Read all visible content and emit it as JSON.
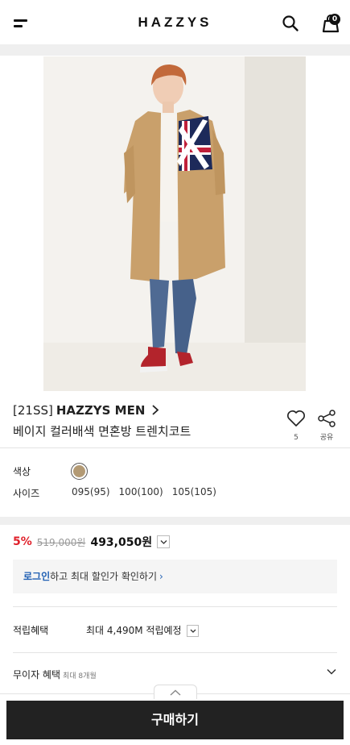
{
  "header": {
    "brand": "HAZZYS",
    "cart_count": "0",
    "icons": [
      "menu-icon",
      "search-icon",
      "cart-icon"
    ]
  },
  "product": {
    "season": "[21SS]",
    "brand_name": "HAZZYS MEN",
    "name": "베이지 컬러배색 면혼방 트렌치코트",
    "wish_count": "5",
    "share_label": "공유"
  },
  "options": {
    "color_label": "색상",
    "size_label": "사이즈",
    "swatch_color": "#b39a74",
    "sizes": [
      "095(95)",
      "100(100)",
      "105(105)"
    ]
  },
  "price": {
    "discount": "5%",
    "original": "519,000원",
    "sale": "493,050원"
  },
  "login_notice": {
    "link": "로그인",
    "text": "하고 최대 할인가 확인하기"
  },
  "points": {
    "label": "적립혜택",
    "value": "최대 4,490M 적립예정"
  },
  "installment": {
    "label": "무이자 혜택",
    "sub": "최대 8개월"
  },
  "buy_button": "구매하기"
}
